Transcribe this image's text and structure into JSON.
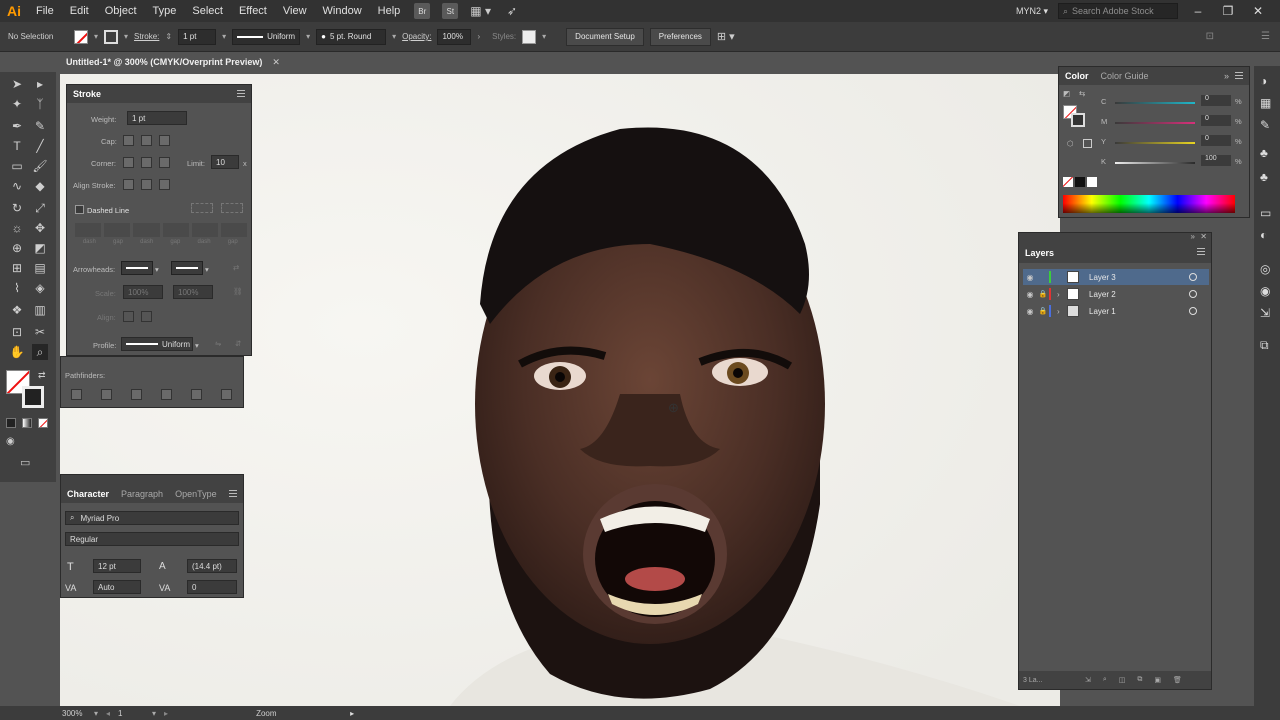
{
  "app": {
    "logo": "Ai"
  },
  "menubar": {
    "items": [
      "File",
      "Edit",
      "Object",
      "Type",
      "Select",
      "Effect",
      "View",
      "Window",
      "Help"
    ],
    "bridge": "Br",
    "stock": "St",
    "workspace": "MYN2",
    "search_placeholder": "Search Adobe Stock"
  },
  "controlbar": {
    "selection": "No Selection",
    "stroke_label": "Stroke:",
    "stroke_weight": "1 pt",
    "uniform": "Uniform",
    "brush": "5 pt. Round",
    "opacity_label": "Opacity:",
    "opacity": "100%",
    "styles_label": "Styles:",
    "doc_setup": "Document Setup",
    "preferences": "Preferences"
  },
  "doctab": {
    "title": "Untitled-1* @ 300% (CMYK/Overprint Preview)",
    "close": "✕"
  },
  "stroke_panel": {
    "title": "Stroke",
    "weight_label": "Weight:",
    "weight": "1 pt",
    "cap_label": "Cap:",
    "corner_label": "Corner:",
    "limit_label": "Limit:",
    "limit": "10",
    "limit_unit": "x",
    "align_label": "Align Stroke:",
    "dashed_label": "Dashed Line",
    "dash_labels": [
      "dash",
      "gap",
      "dash",
      "gap",
      "dash",
      "gap"
    ],
    "arrowheads_label": "Arrowheads:",
    "scale_label": "Scale:",
    "scale1": "100%",
    "scale2": "100%",
    "align2_label": "Align:",
    "profile_label": "Profile:",
    "profile": "Uniform",
    "pathfinders_label": "Pathfinders:"
  },
  "character_panel": {
    "tabs": [
      "Character",
      "Paragraph",
      "OpenType"
    ],
    "font": "Myriad Pro",
    "style": "Regular",
    "size": "12 pt",
    "leading": "(14.4 pt)",
    "kerning": "Auto",
    "tracking": "0"
  },
  "color_panel": {
    "tabs": [
      "Color",
      "Color Guide"
    ],
    "channels": [
      {
        "name": "C",
        "value": "0",
        "unit": "%",
        "color": "#1fb6c9"
      },
      {
        "name": "M",
        "value": "0",
        "unit": "%",
        "color": "#d6307a"
      },
      {
        "name": "Y",
        "value": "0",
        "unit": "%",
        "color": "#e8d422"
      },
      {
        "name": "K",
        "value": "100",
        "unit": "%",
        "color": "#bbbbbb"
      }
    ]
  },
  "layers_panel": {
    "title": "Layers",
    "layers": [
      {
        "name": "Layer 3",
        "color": "#3ccc3c",
        "selected": true
      },
      {
        "name": "Layer 2",
        "color": "#e13333",
        "selected": false
      },
      {
        "name": "Layer 1",
        "color": "#4a6fe0",
        "selected": false
      }
    ],
    "footer": "3 La..."
  },
  "statusbar": {
    "zoom": "300%",
    "artboard": "1",
    "tool": "Zoom"
  }
}
